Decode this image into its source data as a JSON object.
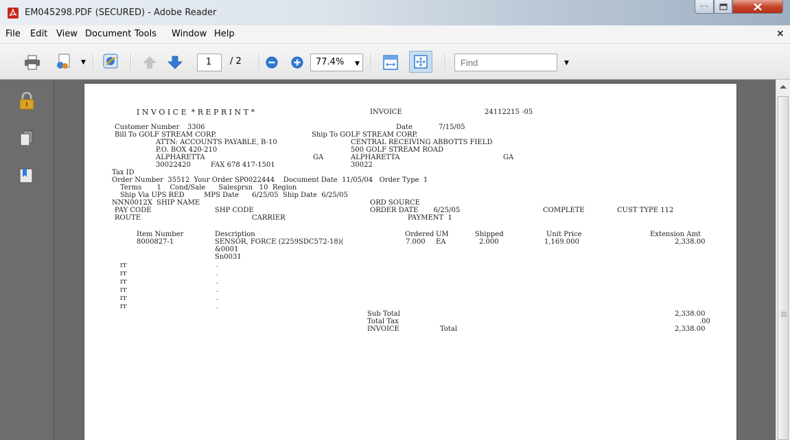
{
  "window": {
    "title": "EM045298.PDF (SECURED) - Adobe Reader"
  },
  "menu": {
    "items": [
      "File",
      "Edit",
      "View",
      "Document",
      "Tools",
      "Window",
      "Help"
    ],
    "close_glyph": "×"
  },
  "toolbar": {
    "page_number": "1",
    "page_total": "/ 2",
    "zoom": "77.4%",
    "find_placeholder": "Find"
  },
  "icons": {
    "print": "print-icon",
    "share": "share-icon",
    "collaborate": "collaborate-icon",
    "prev_page": "arrow-up-icon",
    "next_page": "arrow-down-icon",
    "zoom_out": "zoom-out-icon",
    "zoom_in": "zoom-in-icon",
    "fit_width": "fit-width-icon",
    "fit_page": "fit-page-icon",
    "lock": "lock-icon",
    "pages": "pages-icon",
    "bookmarks": "bookmarks-icon"
  },
  "colors": {
    "accent": "#2f7bd6",
    "close_button": "#c7462b",
    "lock": "#d9a326"
  },
  "invoice": {
    "heading": "I N V O I C E  * R E P R I N T *",
    "invoice_label": "INVOICE",
    "invoice_number": "24112215 -05",
    "customer_number_label": "Customer Number",
    "customer_number": "3306",
    "date_label": "Date",
    "date": "7/15/05",
    "bill_to_line": "Bill To GOLF STREAM CORP.",
    "ship_to_line": "Ship To GOLF STREAM CORP.",
    "bill_attn": "ATTN: ACCOUNTS PAYABLE, B-10",
    "ship_attn": "CENTRAL RECEIVING ABBOTTS FIELD",
    "bill_addr": "P.O. BOX 420-210",
    "ship_addr": "500 GOLF STREAM ROAD",
    "bill_city": "ALPHARETTA",
    "bill_state": "GA",
    "ship_city": "ALPHARETTA",
    "ship_state": "GA",
    "bill_zip": "30022420",
    "bill_fax": "FAX 678 417-1501",
    "ship_zip": "30022",
    "tax_id": "Tax ID",
    "order_line": "Order Number  35512  Your Order SP0022444    Document Date  11/05/04   Order Type  1",
    "terms_line": "Terms       1    Cond/Sale      Salesprsn   10  Region",
    "ship_via_line": "Ship Via UPS RED         MPS Date      6/25/05  Ship Date  6/25/05",
    "ship_name_line": "NNN0012X  SHIP NAME",
    "ord_source": "ORD SOURCE",
    "pay_code": "PAY CODE",
    "shp_code": "SHP CODE",
    "order_date_line": "ORDER DATE       6/25/05",
    "complete": "COMPLETE",
    "cust_type": "CUST TYPE 112",
    "route": "ROUTE",
    "carrier": "CARRIER",
    "payment": "PAYMENT  1",
    "columns": [
      "Item Number",
      "Description",
      "Ordered",
      "UM",
      "Shipped",
      "Unit Price",
      "Extension Amt"
    ],
    "line_item": {
      "item_number": "8000827-1",
      "description": "SENSOR, FORCE (2259SDC572-18)(",
      "ordered": "7.000",
      "um": "EA",
      "shipped": "2.000",
      "unit_price": "1,169.000",
      "extension": "2,338.00",
      "sub1": "&0001",
      "sub2": "Sn0031"
    },
    "filler_rows": [
      "rr",
      "rr",
      "rr",
      "rr",
      "rr",
      "rr"
    ],
    "filler_dots": [
      ".",
      ".",
      ".",
      ".",
      ".",
      "."
    ],
    "sub_total_label": "Sub Total",
    "sub_total": "2,338.00",
    "total_tax_label": "Total Tax",
    "total_tax": ".00",
    "invoice_total_label": "INVOICE",
    "total_label": "Total",
    "invoice_total": "2,338.00"
  }
}
